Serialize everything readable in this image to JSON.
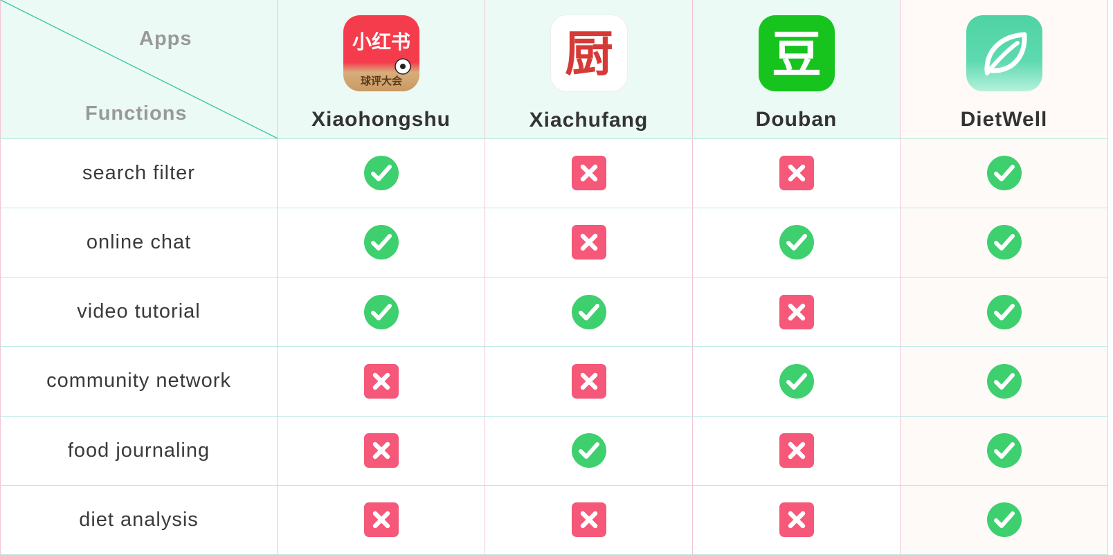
{
  "header": {
    "corner_top": "Apps",
    "corner_bottom": "Functions",
    "apps": [
      {
        "name": "Xiaohongshu",
        "icon": "xiaohongshu-app-icon",
        "icon_glyph": "小红书",
        "icon_caption": "球评大会"
      },
      {
        "name": "Xiachufang",
        "icon": "xiachufang-app-icon",
        "icon_glyph": "厨"
      },
      {
        "name": "Douban",
        "icon": "douban-app-icon",
        "icon_glyph": "豆"
      },
      {
        "name": "DietWell",
        "icon": "dietwell-leaf-app-icon"
      }
    ]
  },
  "rows": [
    {
      "function": "search filter",
      "values": [
        true,
        false,
        false,
        true
      ]
    },
    {
      "function": "online chat",
      "values": [
        true,
        false,
        true,
        true
      ]
    },
    {
      "function": "video tutorial",
      "values": [
        true,
        true,
        false,
        true
      ]
    },
    {
      "function": "community network",
      "values": [
        false,
        false,
        true,
        true
      ]
    },
    {
      "function": "food journaling",
      "values": [
        false,
        true,
        false,
        true
      ]
    },
    {
      "function": "diet analysis",
      "values": [
        false,
        false,
        false,
        true
      ]
    }
  ],
  "colors": {
    "check": "#3ecf6e",
    "cross": "#f55878",
    "header_bg": "#ebfaf4",
    "row_divider": "#bde9e5",
    "col_divider": "#f2c4d6"
  },
  "icons": {
    "yes": "check-circle-icon",
    "no": "cross-square-icon"
  }
}
